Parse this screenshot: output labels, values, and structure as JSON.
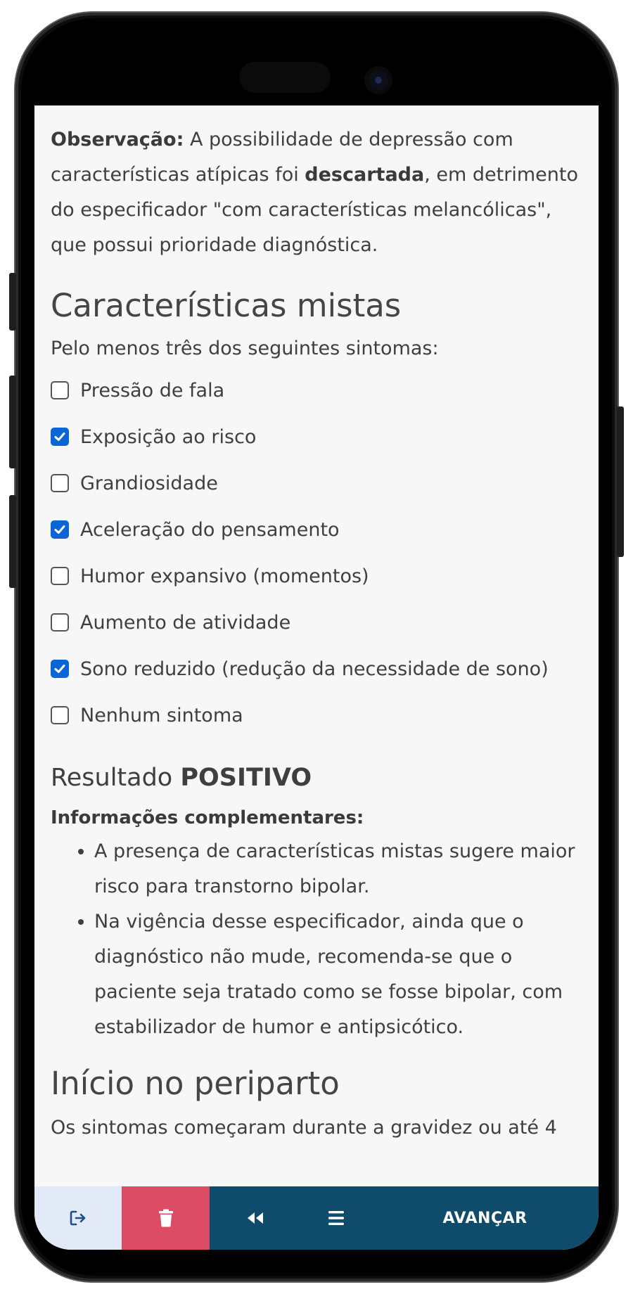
{
  "observation": {
    "label": "Observação:",
    "text_before": " A possibilidade de depressão com características atípicas foi ",
    "emphasis": "descartada",
    "text_after": ", em detrimento do especificador \"com características melancólicas\", que possui prioridade diagnóstica."
  },
  "mixed": {
    "title": "Características mistas",
    "lead": "Pelo menos três dos seguintes sintomas:",
    "options": [
      {
        "label": "Pressão de fala",
        "checked": false
      },
      {
        "label": "Exposição ao risco",
        "checked": true
      },
      {
        "label": "Grandiosidade",
        "checked": false
      },
      {
        "label": "Aceleração do pensamento",
        "checked": true
      },
      {
        "label": "Humor expansivo (momentos)",
        "checked": false
      },
      {
        "label": "Aumento de atividade",
        "checked": false
      },
      {
        "label": "Sono reduzido (redução da necessidade de sono)",
        "checked": true
      },
      {
        "label": "Nenhum sintoma",
        "checked": false
      }
    ]
  },
  "result": {
    "prefix": "Resultado ",
    "value": "POSITIVO"
  },
  "info": {
    "label": "Informações complementares:",
    "items": [
      "A presença de características mistas sugere maior risco para transtorno bipolar.",
      "Na vigência desse especificador, ainda que o diagnóstico não mude, recomenda-se que o paciente seja tratado como se fosse bipolar, com estabilizador de humor e antipsicótico."
    ]
  },
  "peripartum": {
    "title": "Início no periparto",
    "text": "Os sintomas começaram durante a gravidez ou até 4"
  },
  "bottom": {
    "next_label": "AVANÇAR",
    "icons": [
      "sign-out-icon",
      "trash-icon",
      "backward-icon",
      "menu-icon"
    ],
    "colors": {
      "exit_bg": "#e2e9f7",
      "delete_bg": "#dc4c64",
      "nav_bg": "#0f4c6b",
      "check": "#0a66d6"
    }
  }
}
